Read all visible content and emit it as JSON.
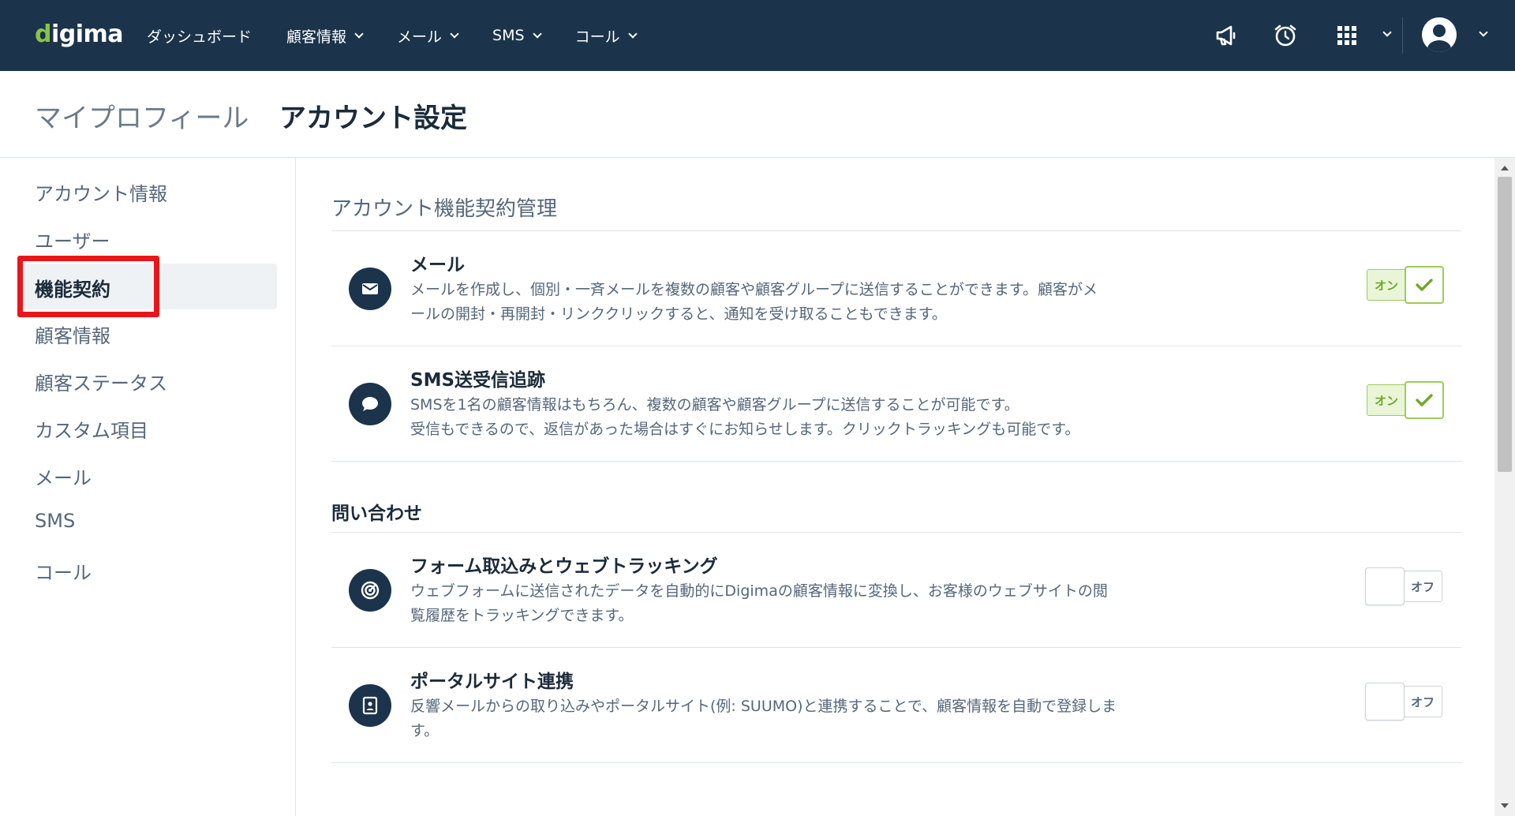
{
  "brand": {
    "logo_text_prefix": "d",
    "logo_text": "igima"
  },
  "nav": {
    "items": [
      {
        "label": "ダッシュボード",
        "dropdown": false
      },
      {
        "label": "顧客情報",
        "dropdown": true
      },
      {
        "label": "メール",
        "dropdown": true
      },
      {
        "label": "SMS",
        "dropdown": true
      },
      {
        "label": "コール",
        "dropdown": true
      }
    ],
    "icons": [
      "megaphone-icon",
      "alarm-clock-icon",
      "apps-grid-icon",
      "user-avatar-icon"
    ]
  },
  "title_tabs": {
    "profile": "マイプロフィール",
    "account": "アカウント設定"
  },
  "sidebar": {
    "items": [
      {
        "label": "アカウント情報"
      },
      {
        "label": "ユーザー"
      },
      {
        "label": "機能契約",
        "active": true
      },
      {
        "label": "顧客情報"
      },
      {
        "label": "顧客ステータス"
      },
      {
        "label": "カスタム項目"
      },
      {
        "label": "メール"
      },
      {
        "label": "SMS"
      },
      {
        "label": "コール"
      }
    ]
  },
  "main": {
    "section_title": "アカウント機能契約管理",
    "group_title": "問い合わせ",
    "features": [
      {
        "title": "メール",
        "desc_line1": "メールを作成し、個別・一斉メールを複数の顧客や顧客グループに送信することができます。顧客がメ",
        "desc_line2": "ールの開封・再開封・リンククリックすると、通知を受け取ることもできます。",
        "icon": "envelope-icon",
        "toggle": "オン",
        "state": "on"
      },
      {
        "title": "SMS送受信追跡",
        "desc_line1": "SMSを1名の顧客情報はもちろん、複数の顧客や顧客グループに送信することが可能です。",
        "desc_line2": "受信もできるので、返信があった場合はすぐにお知らせします。クリックトラッキングも可能です。",
        "icon": "chat-bubble-icon",
        "toggle": "オン",
        "state": "on"
      },
      {
        "title": "フォーム取込みとウェブトラッキング",
        "desc_line1": "ウェブフォームに送信されたデータを自動的にDigimaの顧客情報に変換し、お客様のウェブサイトの閲",
        "desc_line2": "覧履歴をトラッキングできます。",
        "icon": "target-icon",
        "toggle": "オフ",
        "state": "off"
      },
      {
        "title": "ポータルサイト連携",
        "desc_line1": "反響メールからの取り込みやポータルサイト(例: SUUMO)と連携することで、顧客情報を自動で登録しま",
        "desc_line2": "す。",
        "icon": "document-user-icon",
        "toggle": "オフ",
        "state": "off"
      }
    ]
  },
  "colors": {
    "nav_bg": "#1b344b",
    "accent_green": "#8bc34a",
    "highlight_red": "#e8161b"
  }
}
